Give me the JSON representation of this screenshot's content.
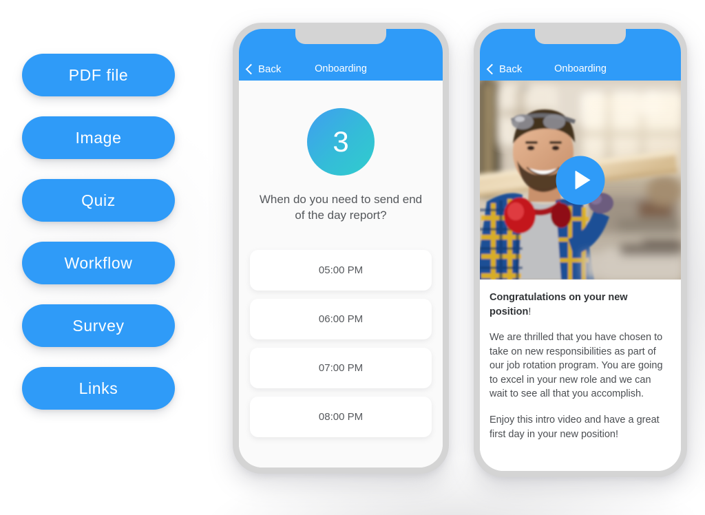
{
  "theme": {
    "accent_blue": "#2f9bf8",
    "badge_gradient_from": "#3f9ef0",
    "badge_gradient_to": "#31cdcd",
    "screen_background": "#fafafa",
    "card_background": "#ffffff",
    "text_color": "#55585c",
    "phone_frame": "#d4d4d4"
  },
  "content_type_buttons": [
    {
      "label": "PDF file",
      "name": "pdf-file-button"
    },
    {
      "label": "Image",
      "name": "image-button"
    },
    {
      "label": "Quiz",
      "name": "quiz-button"
    },
    {
      "label": "Workflow",
      "name": "workflow-button"
    },
    {
      "label": "Survey",
      "name": "survey-button"
    },
    {
      "label": "Links",
      "name": "links-button"
    }
  ],
  "phone_quiz": {
    "nav": {
      "back_label": "Back",
      "back_icon": "chevron-left-icon",
      "title": "Onboarding"
    },
    "badge_number": "3",
    "question": "When do you need to send end of the day report?",
    "options": [
      {
        "label": "05:00 PM"
      },
      {
        "label": "06:00 PM"
      },
      {
        "label": "07:00 PM"
      },
      {
        "label": "08:00 PM"
      }
    ]
  },
  "phone_video": {
    "nav": {
      "back_label": "Back",
      "back_icon": "chevron-left-icon",
      "title": "Onboarding"
    },
    "video": {
      "play_icon": "play-icon",
      "thumbnail_description": "Smiling carpenter in blue and yellow plaid shirt with red ear defenders carrying a wooden plank in a workshop"
    },
    "message": {
      "heading": "Congratulations on your new position",
      "heading_punctuation": "!",
      "paragraph_1": "We are thrilled that you have chosen to take on new responsibilities as part of our job rotation program. You are going to excel in your new role and we can wait to see all that you accomplish.",
      "paragraph_2": "Enjoy this intro video and have a great first day in your new position!"
    }
  }
}
